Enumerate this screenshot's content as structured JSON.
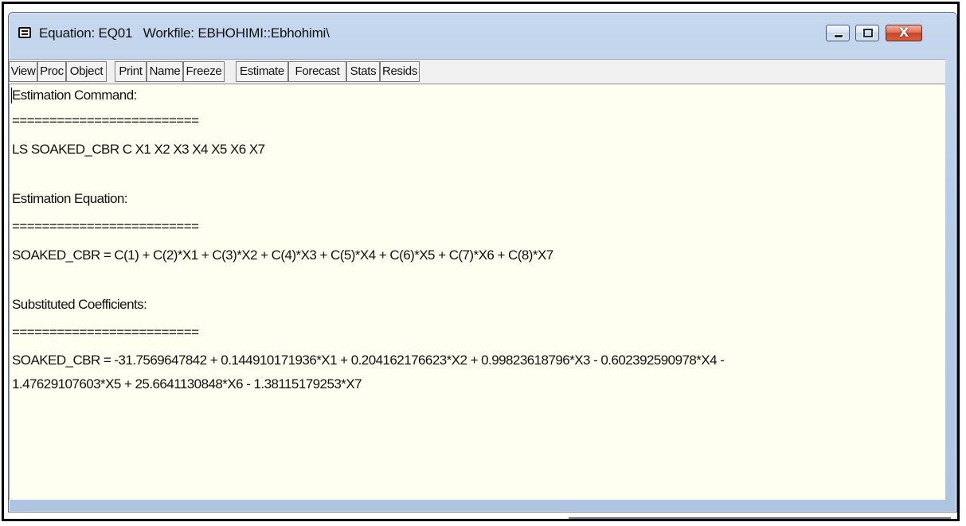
{
  "window": {
    "title": "Equation: EQ01   Workfile: EBHOHIMI::Ebhohimi\\",
    "close_glyph": "X"
  },
  "toolbar": {
    "buttons": [
      "View",
      "Proc",
      "Object",
      "Print",
      "Name",
      "Freeze",
      "Estimate",
      "Forecast",
      "Stats",
      "Resids"
    ]
  },
  "content": {
    "estimation_command_heading": "Estimation Command:",
    "separator_1": "=========================",
    "estimation_command": "LS SOAKED_CBR C X1 X2 X3 X4 X5 X6 X7",
    "estimation_equation_heading": "Estimation Equation:",
    "separator_2": "=========================",
    "estimation_equation": "SOAKED_CBR = C(1) + C(2)*X1 + C(3)*X2 + C(4)*X3 + C(5)*X4 + C(6)*X5 + C(7)*X6 + C(8)*X7",
    "substituted_heading": "Substituted Coefficients:",
    "separator_3": "=========================",
    "substituted_line_1": "SOAKED_CBR = -31.7569647842 + 0.144910171936*X1 + 0.204162176623*X2 + 0.99823618796*X3 - 0.602392590978*X4 -",
    "substituted_line_2": "1.47629107603*X5 + 25.6641130848*X6 - 1.38115179253*X7"
  },
  "icons": {
    "system_menu": "system-menu-icon",
    "minimize": "minimize-icon",
    "maximize": "maximize-icon",
    "close": "close-icon"
  },
  "colors": {
    "content_background": "#fffff1",
    "titlebar": "#b6cbe6",
    "close_button": "#c8442b"
  }
}
